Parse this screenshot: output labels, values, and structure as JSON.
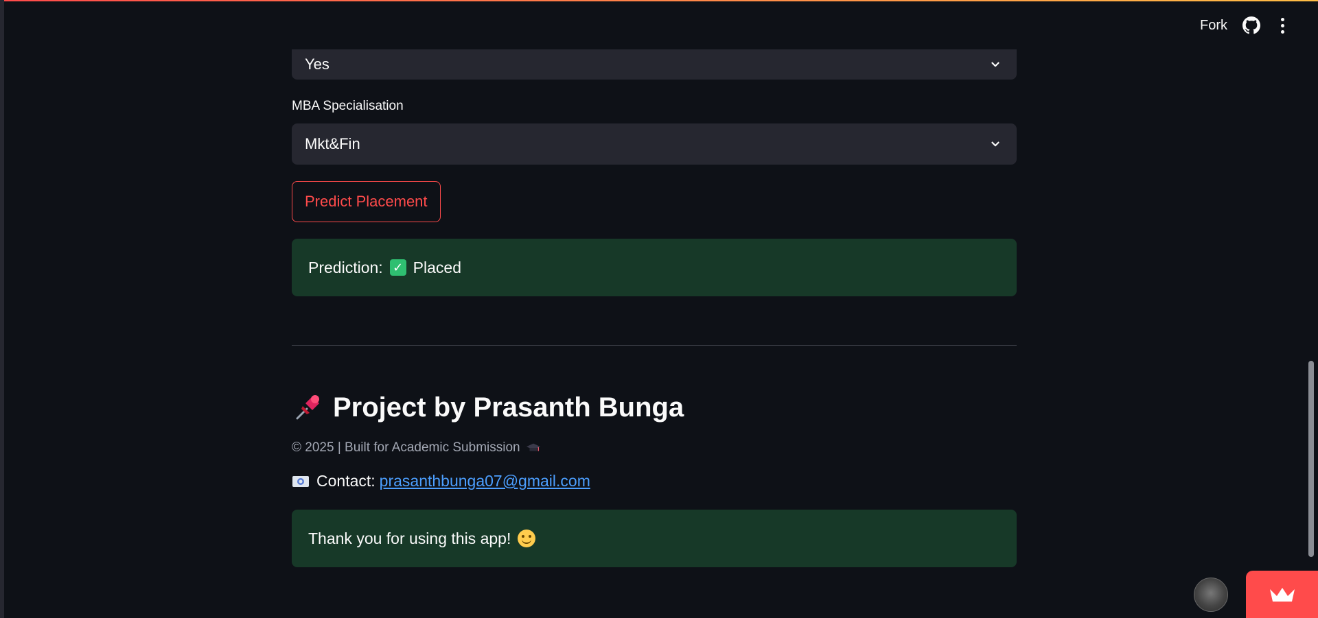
{
  "header": {
    "fork_label": "Fork",
    "github_icon": "github-icon",
    "menu_icon": "vertical-ellipsis-icon"
  },
  "form": {
    "previous_select_value": "Yes",
    "specialisation_label": "MBA Specialisation",
    "specialisation_value": "Mkt&Fin",
    "predict_button_label": "Predict Placement"
  },
  "prediction": {
    "prefix": "Prediction:",
    "icon": "check-mark-icon",
    "result": "Placed"
  },
  "footer": {
    "heading_icon": "pushpin-icon",
    "heading": "Project by Prasanth Bunga",
    "caption": "© 2025 | Built for Academic Submission",
    "caption_icon": "graduation-cap-icon",
    "contact_icon": "envelope-icon",
    "contact_label": "Contact:",
    "contact_email": "prasanthbunga07@gmail.com",
    "thanks_text": "Thank you for using this app!",
    "thanks_icon": "smiling-face-icon"
  },
  "colors": {
    "background": "#0e1117",
    "select_bg": "#262730",
    "accent": "#ff4b4b",
    "success_bg": "#173928",
    "link": "#4c9fff"
  }
}
